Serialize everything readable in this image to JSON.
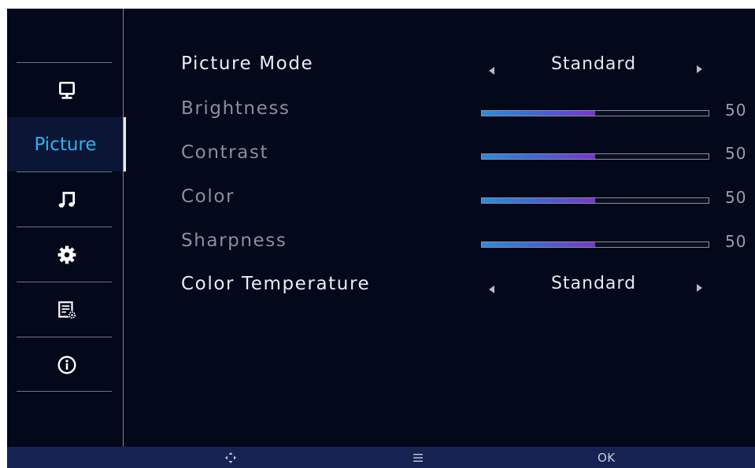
{
  "sidebar": {
    "items": [
      {
        "icon": "monitor-icon",
        "label": ""
      },
      {
        "icon": "",
        "label": "Picture",
        "active": true
      },
      {
        "icon": "music-note-icon",
        "label": ""
      },
      {
        "icon": "gear-icon",
        "label": ""
      },
      {
        "icon": "settings-list-icon",
        "label": ""
      },
      {
        "icon": "info-icon",
        "label": ""
      }
    ]
  },
  "settings": {
    "picture_mode": {
      "label": "Picture Mode",
      "value": "Standard"
    },
    "brightness": {
      "label": "Brightness",
      "value": "50",
      "level": 50
    },
    "contrast": {
      "label": "Contrast",
      "value": "50",
      "level": 50
    },
    "color": {
      "label": "Color",
      "value": "50",
      "level": 50
    },
    "sharpness": {
      "label": "Sharpness",
      "value": "50",
      "level": 50
    },
    "color_temperature": {
      "label": "Color Temperature",
      "value": "Standard"
    }
  },
  "bottom_bar": {
    "ok_label": "OK",
    "icons": [
      "dpad-icon",
      "menu-icon"
    ]
  },
  "colors": {
    "background": "#03081a",
    "active_item": "#0b1636",
    "accent_text": "#2fb0ef",
    "bottom_bar": "#162352",
    "slider_start": "#2a8ddc",
    "slider_end": "#7a34d2"
  }
}
